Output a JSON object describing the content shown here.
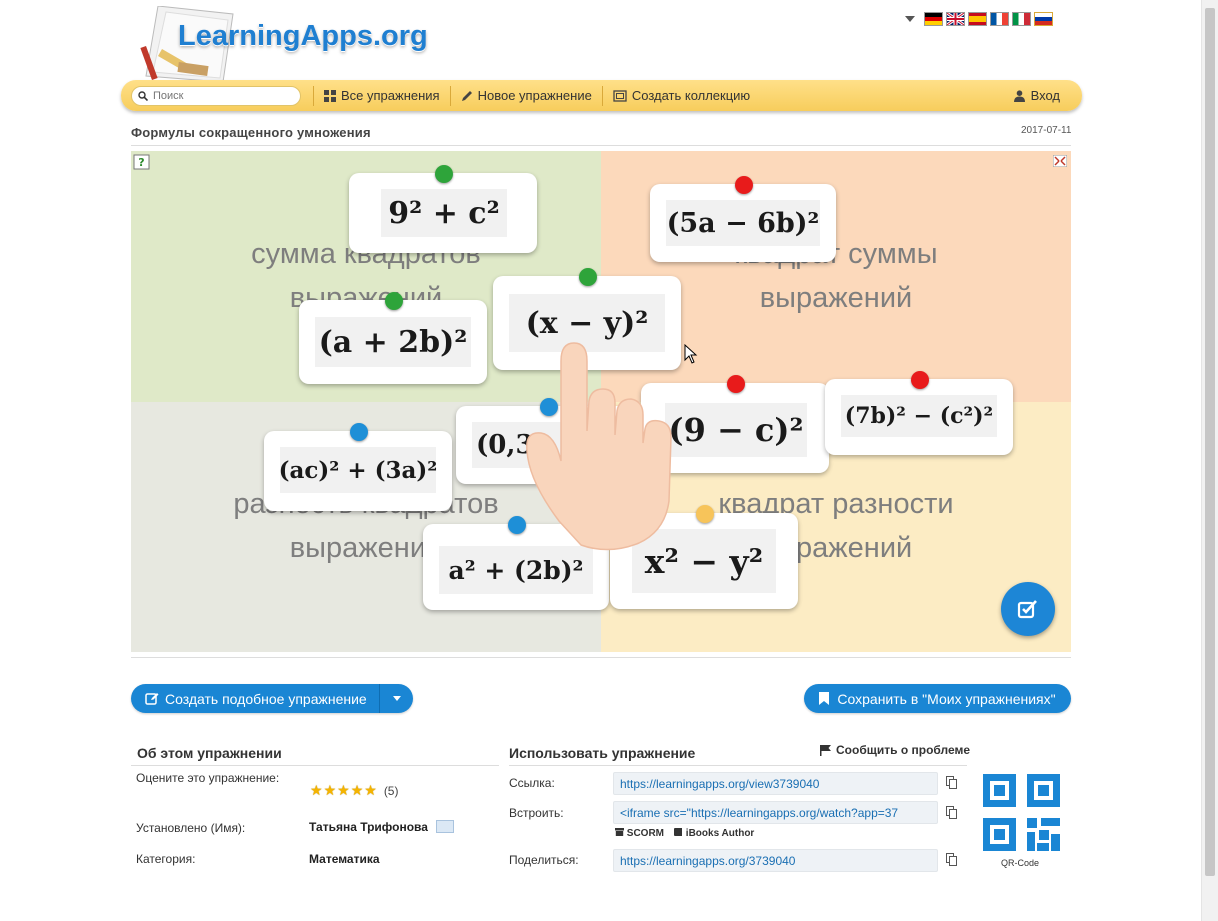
{
  "site": {
    "logo_text": "LearningApps.org"
  },
  "languages": [
    "de",
    "en",
    "es",
    "fr",
    "it",
    "ru"
  ],
  "nav": {
    "search_placeholder": "Поиск",
    "all_exercises": "Все упражнения",
    "new_exercise": "Новое упражнение",
    "create_collection": "Создать коллекцию",
    "login": "Вход"
  },
  "page": {
    "title": "Формулы сокращенного умножения",
    "date": "2017-07-11"
  },
  "board": {
    "categories": [
      {
        "line1": "сумма квадратов",
        "line2": "выражений"
      },
      {
        "line1": "квадрат суммы",
        "line2": "выражений"
      },
      {
        "line1": "разность квадратов",
        "line2": "выражений"
      },
      {
        "line1": "квадрат разности",
        "line2": "выражений"
      }
    ],
    "cards": [
      {
        "formula": "9² + c²",
        "pin": "green"
      },
      {
        "formula": "(5a − 6b)²",
        "pin": "red"
      },
      {
        "formula": "(a + 2b)²",
        "pin": "green"
      },
      {
        "formula": "(x − y)²",
        "pin": "green"
      },
      {
        "formula": "(0,3b",
        "pin": "blue"
      },
      {
        "formula": "(9 − c)²",
        "pin": "red"
      },
      {
        "formula": "(7b)² − (c²)²",
        "pin": "red"
      },
      {
        "formula": "(ac)² + (3a)²",
        "pin": "blue"
      },
      {
        "formula": "a² + (2b)²",
        "pin": "blue"
      },
      {
        "formula": "x² − y²",
        "pin": "yellow"
      }
    ],
    "pin_colors": {
      "green": "#2ea43a",
      "red": "#e81b1b",
      "blue": "#1e8fd7",
      "yellow": "#f7c45a"
    }
  },
  "actions": {
    "create_similar": "Создать подобное упражнение",
    "save_mine": "Сохранить в \"Моих упражнениях\""
  },
  "about": {
    "heading": "Об этом упражнении",
    "rate_label": "Оцените это упражнение:",
    "rating_stars": 5,
    "rating_count": "(5)",
    "author_label": "Установлено (Имя):",
    "author_value": "Татьяна Трифонова",
    "category_label": "Категория:",
    "category_value": "Математика"
  },
  "use": {
    "heading": "Использовать упражнение",
    "report": "Сообщить о проблеме",
    "link_label": "Ссылка:",
    "link_value": "https://learningapps.org/view3739040",
    "embed_label": "Встроить:",
    "embed_value": "<iframe src=\"https://learningapps.org/watch?app=37",
    "scorm": "SCORM",
    "ibooks": "iBooks Author",
    "share_label": "Поделиться:",
    "share_value": "https://learningapps.org/3739040",
    "qr_label": "QR-Code"
  },
  "colors": {
    "accent": "#1a86d4",
    "navbar": "#f7cd5c"
  }
}
